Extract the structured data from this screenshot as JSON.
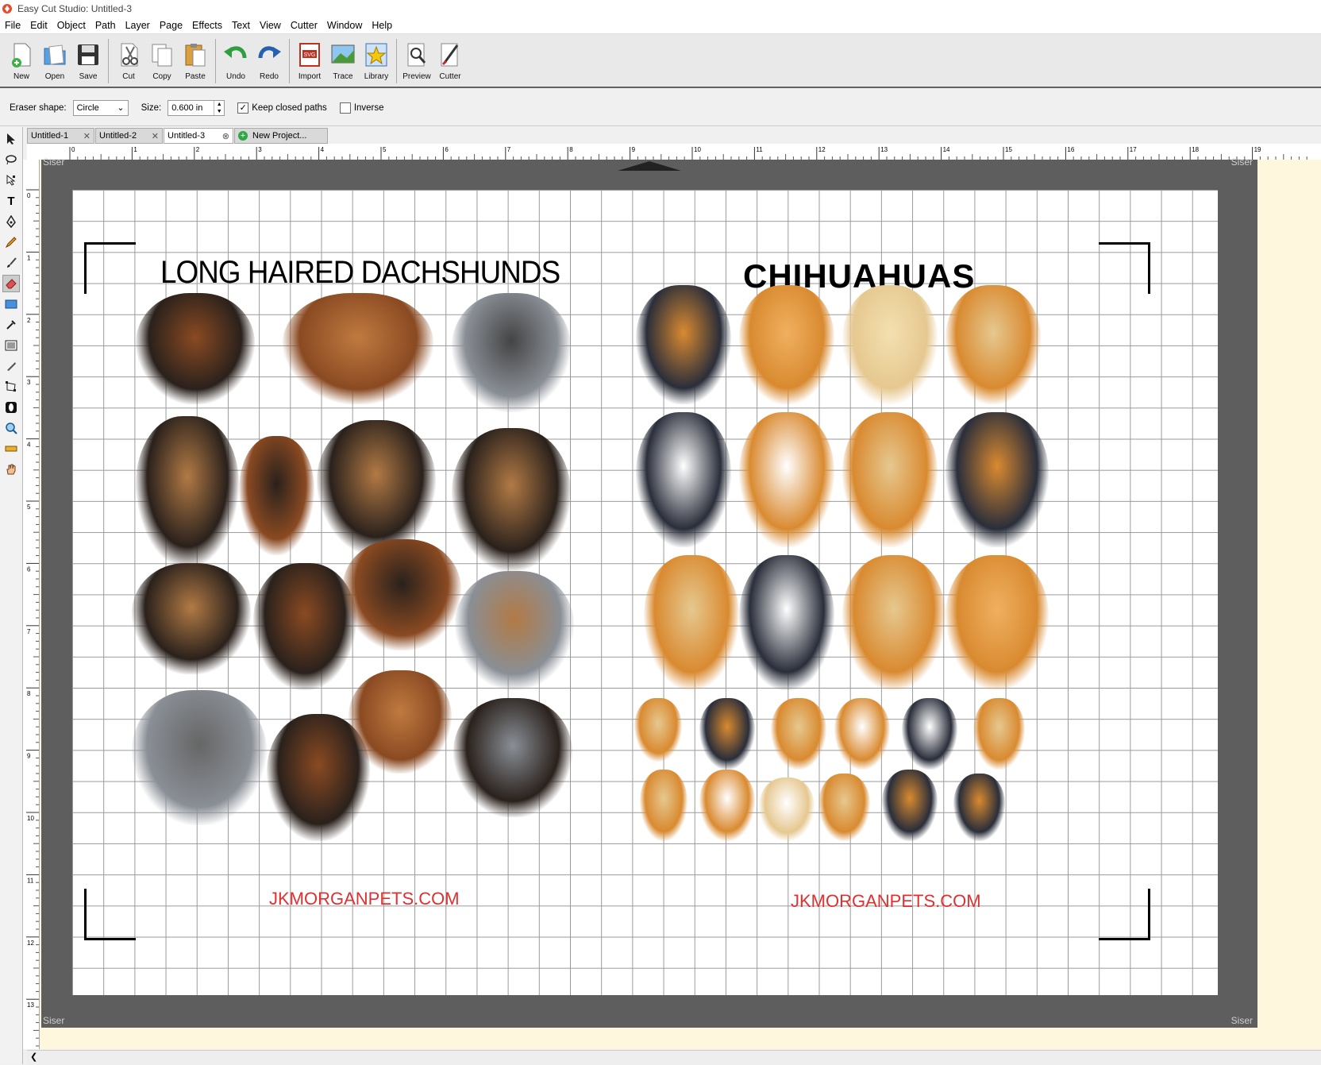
{
  "window": {
    "title": "Easy Cut Studio: Untitled-3"
  },
  "menu": [
    "File",
    "Edit",
    "Object",
    "Path",
    "Layer",
    "Page",
    "Effects",
    "Text",
    "View",
    "Cutter",
    "Window",
    "Help"
  ],
  "toolbar": {
    "new": "New",
    "open": "Open",
    "save": "Save",
    "cut": "Cut",
    "copy": "Copy",
    "paste": "Paste",
    "undo": "Undo",
    "redo": "Redo",
    "import": "Import",
    "trace": "Trace",
    "library": "Library",
    "preview": "Preview",
    "cutter": "Cutter"
  },
  "options": {
    "eraser_label": "Eraser shape:",
    "eraser_value": "Circle",
    "size_label": "Size:",
    "size_value": "0.600 in",
    "keep_closed_label": "Keep closed paths",
    "keep_closed_checked": true,
    "inverse_label": "Inverse",
    "inverse_checked": false
  },
  "tabs": [
    {
      "label": "Untitled-1"
    },
    {
      "label": "Untitled-2"
    },
    {
      "label": "Untitled-3",
      "active": true
    },
    {
      "label": "New Project..."
    }
  ],
  "ruler": {
    "h": [
      "0",
      "1",
      "2",
      "3",
      "4",
      "5",
      "6",
      "7",
      "8",
      "9",
      "10",
      "11",
      "12",
      "13",
      "14",
      "15",
      "16",
      "17",
      "18",
      "19"
    ],
    "v": [
      "0",
      "1",
      "2",
      "3",
      "4",
      "5",
      "6",
      "7",
      "8",
      "9",
      "10",
      "11",
      "12",
      "13"
    ]
  },
  "mat": {
    "brand": "Siser"
  },
  "canvas": {
    "left_title": "LONG HAIRED DACHSHUNDS",
    "right_title": "CHIHUAHUAS",
    "left_url": "JKMORGANPETS.COM",
    "right_url": "JKMORGANPETS.COM"
  },
  "colors": {
    "url": "#e03030",
    "mat": "#5e5e5e",
    "workarea": "#fff7dd"
  }
}
